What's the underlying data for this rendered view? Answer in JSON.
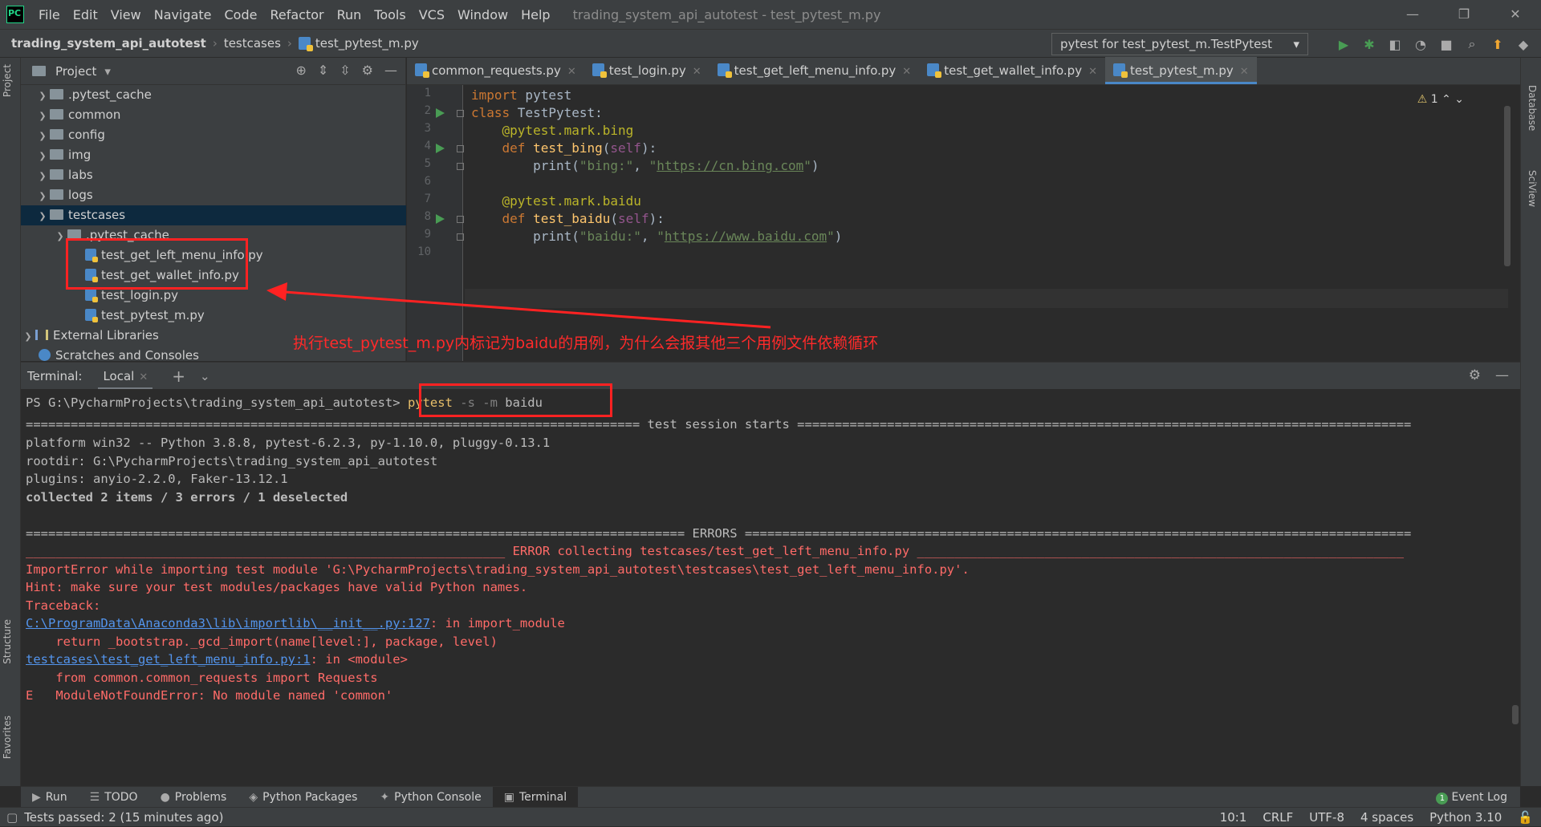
{
  "menubar": {
    "items": [
      "File",
      "Edit",
      "View",
      "Navigate",
      "Code",
      "Refactor",
      "Run",
      "Tools",
      "VCS",
      "Window",
      "Help"
    ],
    "title": "trading_system_api_autotest - test_pytest_m.py"
  },
  "navbar": {
    "crumbs": [
      "trading_system_api_autotest",
      "testcases",
      "test_pytest_m.py"
    ],
    "run_config": "pytest for test_pytest_m.TestPytest"
  },
  "project": {
    "title": "Project",
    "tree": [
      {
        "label": ".pytest_cache",
        "type": "folder"
      },
      {
        "label": "common",
        "type": "folder"
      },
      {
        "label": "config",
        "type": "folder"
      },
      {
        "label": "img",
        "type": "folder"
      },
      {
        "label": "labs",
        "type": "folder"
      },
      {
        "label": "logs",
        "type": "folder"
      },
      {
        "label": "testcases",
        "type": "folder",
        "expanded": true
      },
      {
        "label": ".pytest_cache",
        "type": "folder"
      },
      {
        "label": "test_get_left_menu_info.py",
        "type": "py"
      },
      {
        "label": "test_get_wallet_info.py",
        "type": "py"
      },
      {
        "label": "test_login.py",
        "type": "py"
      },
      {
        "label": "test_pytest_m.py",
        "type": "py"
      },
      {
        "label": "External Libraries",
        "type": "lib"
      },
      {
        "label": "Scratches and Consoles",
        "type": "scratch"
      }
    ]
  },
  "editor": {
    "tabs": [
      "common_requests.py",
      "test_login.py",
      "test_get_left_menu_info.py",
      "test_get_wallet_info.py",
      "test_pytest_m.py"
    ],
    "active_tab": 4,
    "line_numbers": [
      "1",
      "2",
      "3",
      "4",
      "5",
      "6",
      "7",
      "8",
      "9",
      "10"
    ],
    "warning_count": "1",
    "code": {
      "l1_kw": "import",
      "l1_rest": " pytest",
      "l2_kw": "class",
      "l2_rest": " TestPytest:",
      "l3": "    @pytest.mark.bing",
      "l4_kw": "    def",
      "l4_fn": " test_bing",
      "l4_self": "self",
      "l4_end": "):",
      "l5_a": "        print(",
      "l5_s1": "\"bing:\"",
      "l5_b": ", ",
      "l5_q1": "\"",
      "l5_url": "https://cn.bing.com",
      "l5_q2": "\"",
      "l5_c": ")",
      "l7": "    @pytest.mark.baidu",
      "l8_kw": "    def",
      "l8_fn": " test_baidu",
      "l8_self": "self",
      "l8_end": "):",
      "l9_a": "        print(",
      "l9_s1": "\"baidu:\"",
      "l9_b": ", ",
      "l9_q1": "\"",
      "l9_url": "https://www.baidu.com",
      "l9_q2": "\"",
      "l9_c": ")"
    }
  },
  "annotation": "执行test_pytest_m.py内标记为baidu的用例，为什么会报其他三个用例文件依赖循环",
  "terminal": {
    "label": "Terminal:",
    "tab": "Local",
    "prompt": "PS G:\\PycharmProjects\\trading_system_api_autotest>",
    "cmd": "pytest",
    "flags": "-s -m",
    "arg": "baidu",
    "lines": {
      "session": "================================================================================== test session starts ==================================================================================",
      "platform": "platform win32 -- Python 3.8.8, pytest-6.2.3, py-1.10.0, pluggy-0.13.1",
      "rootdir": "rootdir: G:\\PycharmProjects\\trading_system_api_autotest",
      "plugins": "plugins: anyio-2.2.0, Faker-13.12.1",
      "collected": "collected 2 items / 3 errors / 1 deselected",
      "errors": "======================================================================================== ERRORS =========================================================================================",
      "errcollect": "________________________________________________________________ ERROR collecting testcases/test_get_left_menu_info.py _________________________________________________________________",
      "importerr": "ImportError while importing test module 'G:\\PycharmProjects\\trading_system_api_autotest\\testcases\\test_get_left_menu_info.py'.",
      "hint": "Hint: make sure your test modules/packages have valid Python names.",
      "traceback": "Traceback:",
      "tb1_link": "C:\\ProgramData\\Anaconda3\\lib\\importlib\\__init__.py:127",
      "tb1_rest": ": in import_module",
      "tb1_code": "    return _bootstrap._gcd_import(name[level:], package, level)",
      "tb2_link": "testcases\\test_get_left_menu_info.py:1",
      "tb2_rest": ": in <module>",
      "tb2_code": "    from common.common_requests import Requests",
      "err": "E   ModuleNotFoundError: No module named 'common'"
    }
  },
  "bottom_tabs": [
    "Run",
    "TODO",
    "Problems",
    "Python Packages",
    "Python Console",
    "Terminal"
  ],
  "event_log": "Event Log",
  "event_count": "1",
  "side_tabs": {
    "project": "Project",
    "structure": "Structure",
    "favorites": "Favorites",
    "database": "Database",
    "sciview": "SciView"
  },
  "status": {
    "message": "Tests passed: 2 (15 minutes ago)",
    "position": "10:1",
    "line_sep": "CRLF",
    "encoding": "UTF-8",
    "indent": "4 spaces",
    "interpreter": "Python 3.10"
  },
  "colors": {
    "accent": "#4a88c7",
    "annotation": "#ff2222",
    "error": "#ff6b68",
    "run": "#499c54"
  }
}
